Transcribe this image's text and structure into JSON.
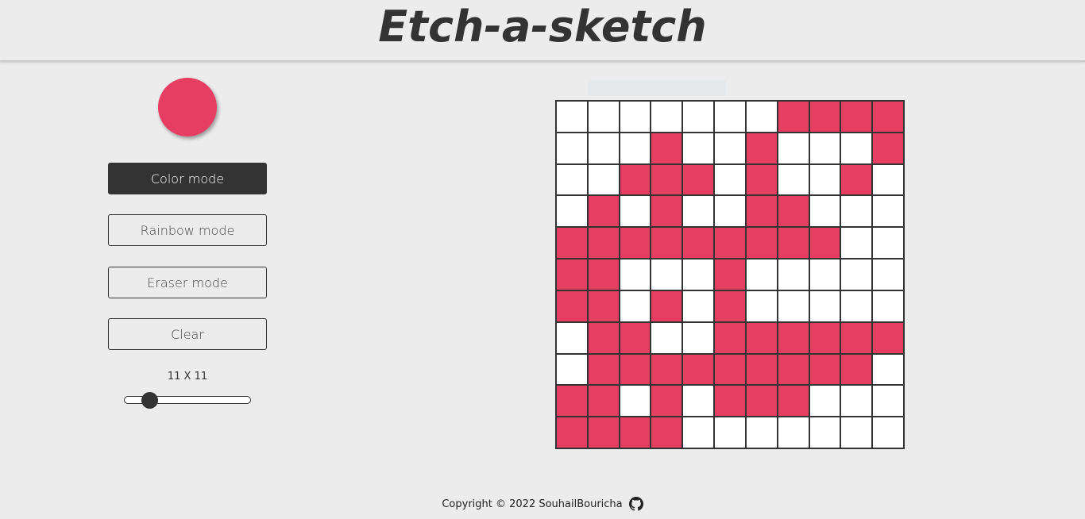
{
  "header": {
    "title": "Etch-a-sketch"
  },
  "colors": {
    "paint": "#e63e62",
    "dark": "#333333",
    "cell_empty": "#ffffff",
    "background": "#ececec"
  },
  "controls": {
    "color_mode_label": "Color mode",
    "rainbow_mode_label": "Rainbow mode",
    "eraser_mode_label": "Eraser mode",
    "clear_label": "Clear",
    "active_mode": "color",
    "size_label": "11 X 11",
    "size_value": 11
  },
  "grid": {
    "size": 11,
    "cells": [
      [
        0,
        0,
        0,
        0,
        0,
        0,
        0,
        1,
        1,
        1,
        1
      ],
      [
        0,
        0,
        0,
        1,
        0,
        0,
        1,
        0,
        0,
        0,
        1
      ],
      [
        0,
        0,
        1,
        1,
        1,
        0,
        1,
        0,
        0,
        1,
        0
      ],
      [
        0,
        1,
        0,
        1,
        0,
        0,
        1,
        1,
        0,
        0,
        0
      ],
      [
        1,
        1,
        1,
        1,
        1,
        1,
        1,
        1,
        1,
        0,
        0
      ],
      [
        1,
        1,
        0,
        0,
        0,
        1,
        0,
        0,
        0,
        0,
        0
      ],
      [
        1,
        1,
        0,
        1,
        0,
        1,
        0,
        0,
        0,
        0,
        0
      ],
      [
        0,
        1,
        1,
        0,
        0,
        1,
        1,
        1,
        1,
        1,
        1
      ],
      [
        0,
        1,
        1,
        1,
        1,
        1,
        1,
        1,
        1,
        1,
        0
      ],
      [
        1,
        1,
        0,
        1,
        0,
        1,
        1,
        1,
        0,
        0,
        0
      ],
      [
        1,
        1,
        1,
        1,
        0,
        0,
        0,
        0,
        0,
        0,
        0
      ]
    ]
  },
  "footer": {
    "copyright": "Copyright © 2022 SouhailBouricha",
    "github_icon": "github-icon"
  }
}
